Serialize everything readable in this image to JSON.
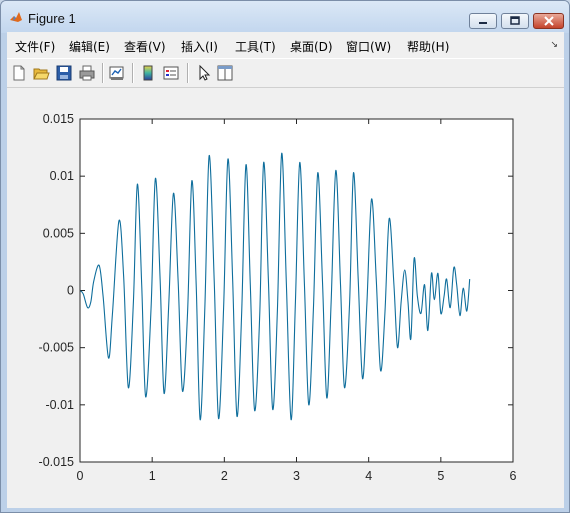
{
  "window": {
    "title": "Figure 1",
    "controls": [
      "minimize",
      "maximize",
      "close"
    ]
  },
  "menubar": {
    "items": [
      {
        "label": "文件(F)"
      },
      {
        "label": "编辑(E)"
      },
      {
        "label": "查看(V)"
      },
      {
        "label": "插入(I)"
      },
      {
        "label": "工具(T)"
      },
      {
        "label": "桌面(D)"
      },
      {
        "label": "窗口(W)"
      },
      {
        "label": "帮助(H)"
      }
    ]
  },
  "toolbar": {
    "icons": [
      "new-figure-icon",
      "open-file-icon",
      "save-icon",
      "print-icon",
      "link-plot-icon",
      "insert-colorbar-icon",
      "insert-legend-icon",
      "edit-plot-icon",
      "property-editor-icon"
    ]
  },
  "colors": {
    "line": "#0f6e9c",
    "axes_background": "#ffffff",
    "figure_background": "#f0f0f0"
  },
  "chart_data": {
    "type": "line",
    "xlim": [
      0,
      6
    ],
    "ylim": [
      -0.015,
      0.015
    ],
    "xticks": [
      "0",
      "1",
      "2",
      "3",
      "4",
      "5",
      "6"
    ],
    "yticks": [
      "0.015",
      "0.01",
      "0.005",
      "0",
      "-0.005",
      "-0.01",
      "-0.015"
    ],
    "grid": false,
    "series": [
      {
        "color": "#0f6e9c",
        "x": [
          0.0,
          0.045,
          0.105,
          0.15,
          0.19,
          0.265,
          0.32,
          0.395,
          0.45,
          0.54,
          0.605,
          0.67,
          0.74,
          0.795,
          0.855,
          0.91,
          0.985,
          1.045,
          1.11,
          1.165,
          1.23,
          1.295,
          1.36,
          1.42,
          1.49,
          1.55,
          1.61,
          1.665,
          1.73,
          1.79,
          1.86,
          1.92,
          1.99,
          2.05,
          2.115,
          2.175,
          2.24,
          2.3,
          2.36,
          2.42,
          2.49,
          2.545,
          2.61,
          2.67,
          2.735,
          2.795,
          2.86,
          2.925,
          2.985,
          3.045,
          3.11,
          3.17,
          3.235,
          3.295,
          3.36,
          3.42,
          3.48,
          3.545,
          3.61,
          3.665,
          3.735,
          3.79,
          3.855,
          3.915,
          3.975,
          4.04,
          4.105,
          4.165,
          4.225,
          4.285,
          4.35,
          4.4,
          4.45,
          4.5,
          4.545,
          4.585,
          4.63,
          4.675,
          4.725,
          4.775,
          4.82,
          4.87,
          4.91,
          4.96,
          5.0,
          5.045,
          5.08,
          5.13,
          5.18,
          5.22,
          5.265,
          5.31,
          5.36,
          5.4
        ],
        "y": [
          0.0,
          -0.0003,
          -0.0015,
          -0.001,
          0.0008,
          0.0022,
          -0.0005,
          -0.0059,
          -0.002,
          0.0061,
          0.0012,
          -0.0085,
          -0.001,
          0.0093,
          0.0005,
          -0.0093,
          -0.0015,
          0.0098,
          0.001,
          -0.009,
          -0.0012,
          0.0085,
          0.0008,
          -0.0088,
          -0.002,
          0.0096,
          0.0005,
          -0.0113,
          -0.0015,
          0.0118,
          0.0008,
          -0.0112,
          -0.0015,
          0.0115,
          0.001,
          -0.011,
          -0.002,
          0.011,
          0.0005,
          -0.0105,
          -0.0022,
          0.0112,
          0.001,
          -0.0104,
          -0.0018,
          0.012,
          0.0005,
          -0.0113,
          -0.001,
          0.0112,
          0.0005,
          -0.01,
          -0.0015,
          0.0103,
          0.0008,
          -0.0094,
          -0.001,
          0.0105,
          0.0005,
          -0.0085,
          -0.0012,
          0.0103,
          0.001,
          -0.0077,
          -0.0012,
          0.008,
          0.001,
          -0.007,
          -0.002,
          0.0063,
          0.0005,
          -0.005,
          -0.001,
          0.0018,
          -0.001,
          -0.0042,
          0.0028,
          -0.0005,
          -0.002,
          0.0005,
          -0.0035,
          0.0015,
          -0.0008,
          0.0015,
          -0.002,
          -0.0005,
          0.001,
          -0.0015,
          0.002,
          0.0005,
          -0.0022,
          0.0002,
          -0.0018,
          0.001
        ]
      }
    ]
  }
}
